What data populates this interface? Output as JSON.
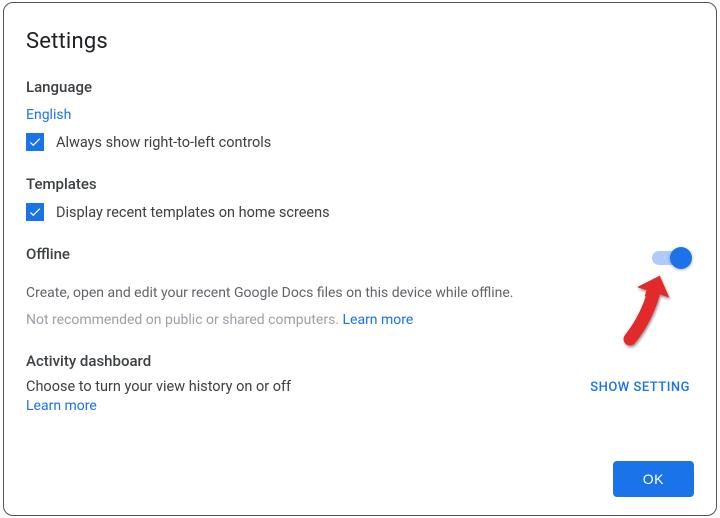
{
  "title": "Settings",
  "language": {
    "heading": "Language",
    "value": "English",
    "rtl_checkbox_label": "Always show right-to-left controls"
  },
  "templates": {
    "heading": "Templates",
    "checkbox_label": "Display recent templates on home screens"
  },
  "offline": {
    "heading": "Offline",
    "description": "Create, open and edit your recent Google Docs files on this device while offline.",
    "warning": "Not recommended on public or shared computers. ",
    "learn_more": "Learn more"
  },
  "activity": {
    "heading": "Activity dashboard",
    "description": "Choose to turn your view history on or off",
    "learn_more": "Learn more",
    "button": "SHOW SETTING"
  },
  "footer": {
    "ok": "OK"
  }
}
